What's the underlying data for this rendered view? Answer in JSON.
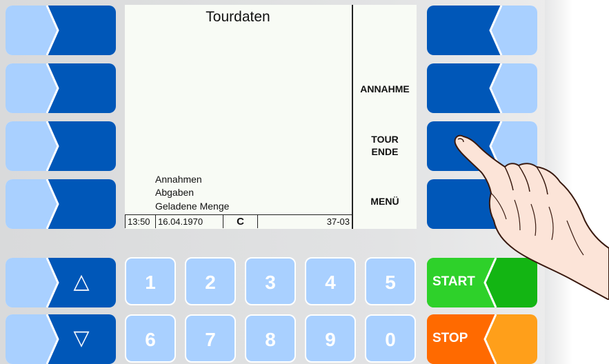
{
  "screen": {
    "title": "Tourdaten",
    "softkey_labels": {
      "annahme": "ANNAHME",
      "tour_line1": "TOUR",
      "tour_line2": "ENDE",
      "menu": "MENÜ"
    },
    "info_lines": [
      "Annahmen",
      "Abgaben",
      "Geladene Menge"
    ],
    "status": {
      "time": "13:50",
      "date": "16.04.1970",
      "mode": "C",
      "code": "37-03"
    }
  },
  "keypad": {
    "up_arrow": "△",
    "down_arrow": "▽",
    "digits_row1": [
      "1",
      "2",
      "3",
      "4",
      "5"
    ],
    "digits_row2": [
      "6",
      "7",
      "8",
      "9",
      "0"
    ],
    "start_label": "START",
    "stop_label": "STOP"
  },
  "colors": {
    "key_dark_blue": "#0057b8",
    "key_light_blue": "#a9d0ff",
    "start_green": "#2ed12a",
    "stop_orange": "#ff7a00"
  }
}
